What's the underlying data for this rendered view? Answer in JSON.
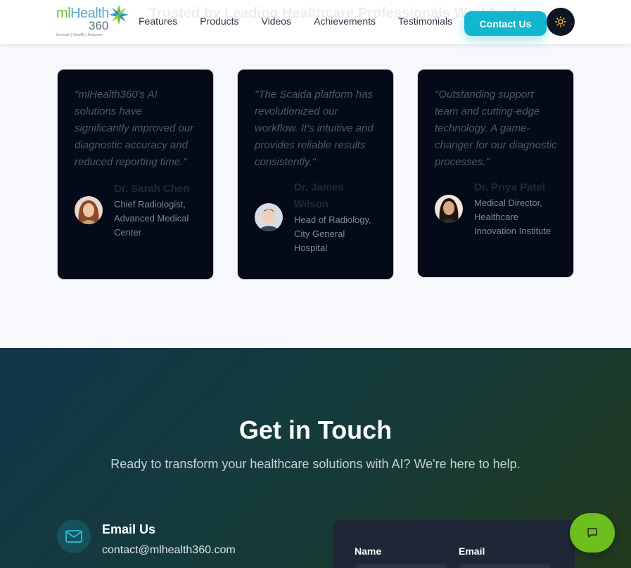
{
  "header": {
    "logo": {
      "brand_prefix": "ml",
      "brand_main": "Health",
      "brand_number": "360",
      "tagline": "Innovate | Simplify | Empower"
    },
    "ghost_heading": "Trusted by Leading Healthcare Professionals Worldwide",
    "nav": [
      {
        "label": "Features"
      },
      {
        "label": "Products"
      },
      {
        "label": "Videos"
      },
      {
        "label": "Achievements"
      },
      {
        "label": "Testimonials"
      }
    ],
    "contact_button": "Contact Us",
    "theme_toggle_icon": "sun-icon"
  },
  "testimonials": [
    {
      "quote": "\"mlHealth360's AI solutions have significantly improved our diagnostic accuracy and reduced reporting time.\"",
      "name": "Dr. Sarah Chen",
      "role": "Chief Radiologist, Advanced Medical Center"
    },
    {
      "quote": "\"The Scaida platform has revolutionized our workflow. It's intuitive and provides reliable results consistently.\"",
      "name": "Dr. James Wilson",
      "role": "Head of Radiology, City General Hospital"
    },
    {
      "quote": "\"Outstanding support team and cutting-edge technology. A game-changer for our diagnostic processes.\"",
      "name": "Dr. Priya Patel",
      "role": "Medical Director, Healthcare Innovation Institute"
    }
  ],
  "contact": {
    "title": "Get in Touch",
    "subtitle": "Ready to transform your healthcare solutions with AI? We're here to help.",
    "email_label": "Email Us",
    "email_value": "contact@mlhealth360.com",
    "form": {
      "name_label": "Name",
      "email_label": "Email"
    }
  },
  "chat_icon": "chat-bubble-icon",
  "colors": {
    "accent": "#12b6cf",
    "card_bg": "#050a18",
    "chat": "#6cbf1e"
  }
}
